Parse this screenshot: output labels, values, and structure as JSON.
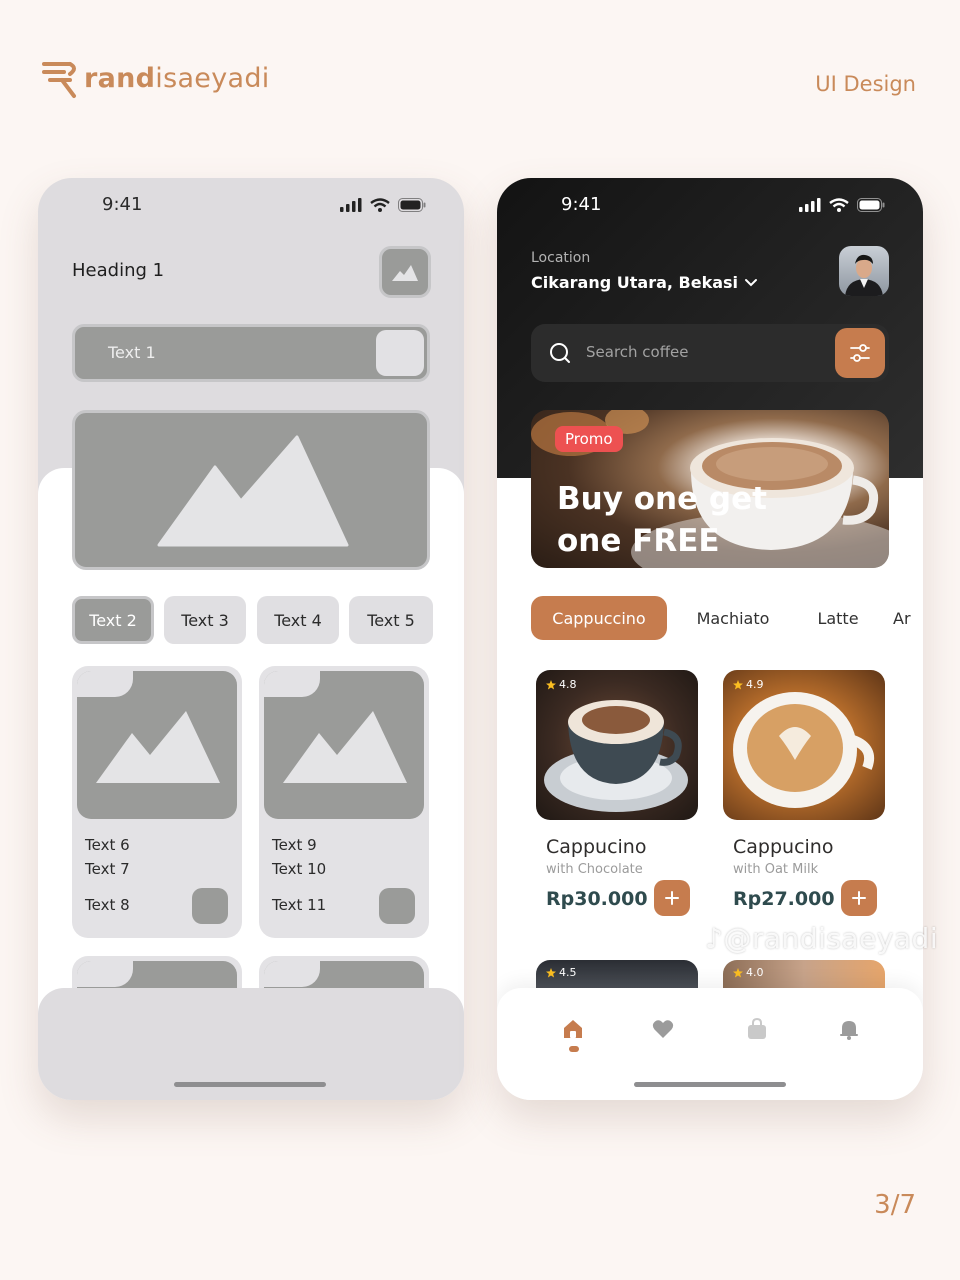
{
  "header": {
    "brand_bold": "rand",
    "brand_regular": "isaeyadi",
    "design_label": "UI Design",
    "page_number": "3/7",
    "watermark": "@randisaeyadi"
  },
  "wireframe": {
    "status_time": "9:41",
    "heading": "Heading 1",
    "search_text": "Text 1",
    "chips": [
      "Text 2",
      "Text 3",
      "Text 4",
      "Text 5"
    ],
    "cards": [
      {
        "line1": "Text 6",
        "line2": "Text 7",
        "line3": "Text 8"
      },
      {
        "line1": "Text 9",
        "line2": "Text 10",
        "line3": "Text 11"
      }
    ]
  },
  "coffee_app": {
    "status_time": "9:41",
    "location_label": "Location",
    "location_value": "Cikarang Utara, Bekasi",
    "search_placeholder": "Search coffee",
    "promo": {
      "badge": "Promo",
      "title": "Buy one get one FREE"
    },
    "tabs": [
      "Cappuccino",
      "Machiato",
      "Latte",
      "Ar"
    ],
    "products": [
      {
        "rating": "4.8",
        "name": "Cappucino",
        "subtitle": "with Chocolate",
        "price": "Rp30.000"
      },
      {
        "rating": "4.9",
        "name": "Cappucino",
        "subtitle": "with Oat Milk",
        "price": "Rp27.000"
      }
    ],
    "more_ratings": [
      "4.5",
      "4.0"
    ],
    "nav_items": [
      "home-icon",
      "heart-icon",
      "bag-icon",
      "bell-icon"
    ],
    "accent_color": "#C67C4E"
  }
}
